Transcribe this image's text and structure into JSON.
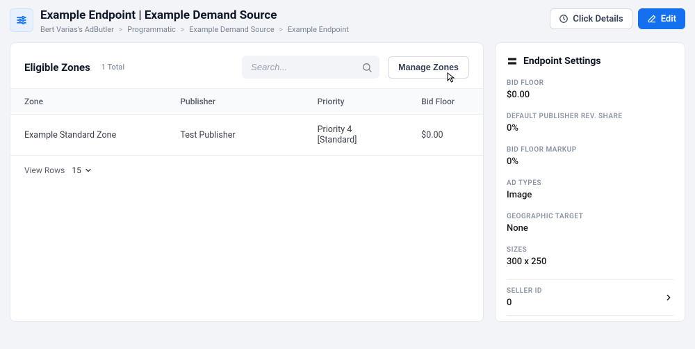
{
  "header": {
    "title": "Example Endpoint | Example Demand Source",
    "breadcrumb": [
      "Bert Varias's AdButler",
      "Programmatic",
      "Example Demand Source",
      "Example Endpoint"
    ],
    "actions": {
      "click_details_label": "Click Details",
      "edit_label": "Edit"
    }
  },
  "zones_panel": {
    "title": "Eligible Zones",
    "total_label": "1 Total",
    "search_placeholder": "Search...",
    "manage_label": "Manage Zones",
    "columns": {
      "zone": "Zone",
      "publisher": "Publisher",
      "priority": "Priority",
      "bid_floor": "Bid Floor"
    },
    "rows": [
      {
        "zone": "Example Standard Zone",
        "publisher": "Test Publisher",
        "priority": "Priority 4 [Standard]",
        "bid_floor": "$0.00"
      }
    ],
    "footer": {
      "view_rows_label": "View Rows",
      "rows_value": "15"
    }
  },
  "settings_panel": {
    "title": "Endpoint Settings",
    "items": {
      "bid_floor": {
        "label": "BID FLOOR",
        "value": "$0.00"
      },
      "rev_share": {
        "label": "DEFAULT PUBLISHER REV. SHARE",
        "value": "0%"
      },
      "markup": {
        "label": "BID FLOOR MARKUP",
        "value": "0%"
      },
      "ad_types": {
        "label": "AD TYPES",
        "value": "Image"
      },
      "geo_target": {
        "label": "GEOGRAPHIC TARGET",
        "value": "None"
      },
      "sizes": {
        "label": "SIZES",
        "value": "300 x 250"
      },
      "seller_id": {
        "label": "SELLER ID",
        "value": "0"
      }
    }
  }
}
